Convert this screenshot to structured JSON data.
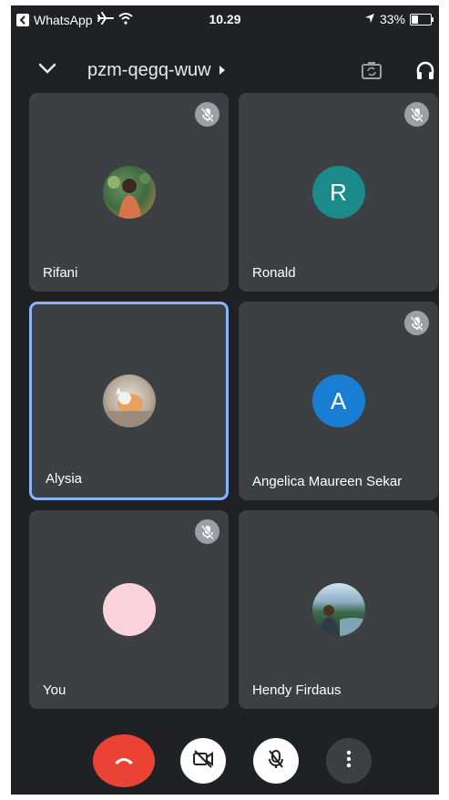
{
  "status_bar": {
    "back_app": "WhatsApp",
    "time": "10.29",
    "battery": "33%",
    "battery_level": 0.33
  },
  "header": {
    "meeting_code": "pzm-qegq-wuw"
  },
  "participants": [
    {
      "name": "Rifani",
      "muted": true,
      "avatar_type": "photo"
    },
    {
      "name": "Ronald",
      "muted": true,
      "avatar_type": "initial",
      "initial": "R",
      "color": "#1a8a8a"
    },
    {
      "name": "Alysia",
      "muted": false,
      "active_speaker": true,
      "avatar_type": "photo"
    },
    {
      "name": "Angelica Maureen Sekar",
      "muted": true,
      "avatar_type": "initial",
      "initial": "A",
      "color": "#1a7fd4"
    },
    {
      "name": "You",
      "muted": true,
      "avatar_type": "blank",
      "color": "#fad2dc"
    },
    {
      "name": "Hendy Firdaus",
      "muted": false,
      "avatar_type": "photo"
    }
  ],
  "colors": {
    "background": "#202124",
    "tile": "#3c4043",
    "active_border": "#8ab4f8",
    "end_call": "#ea4335"
  }
}
